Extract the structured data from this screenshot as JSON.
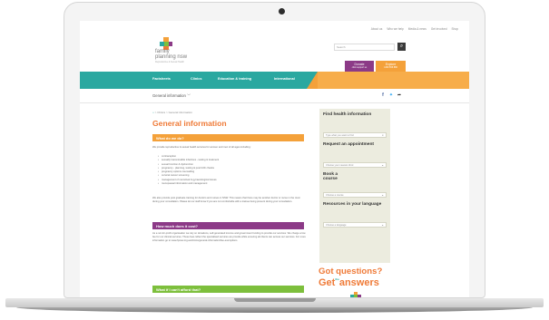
{
  "site": {
    "utility_links": [
      "About us",
      "Who we help",
      "Media & news",
      "Get involved",
      "Shop"
    ],
    "logo_line1": "family",
    "logo_line2": "planning nsw",
    "logo_tagline": "Reproductive & Sexual Health",
    "search_placeholder": "Search",
    "donate": {
      "label": "Donate",
      "sub": "click support us"
    },
    "explore": {
      "label": "Explore",
      "sub": "1300 658 886"
    }
  },
  "nav": [
    "Factsheets",
    "Clinics",
    "Education & training",
    "International"
  ],
  "subbar_title": "General information",
  "breadcrumb": {
    "home": "⌂",
    "sep": ">",
    "clinics": "Clinics",
    "current": "General information"
  },
  "page_title": "General information",
  "sections": {
    "what_we_do": "What do we do?",
    "how_much": "How much does it cost?",
    "cant_afford": "What if I can't afford that?"
  },
  "paragraphs": {
    "intro": "We provide reproductive & sexual health services for women and men of all ages including:",
    "staff": "We also provide post graduate training for doctors and nurses in NSW. This means that there may be another doctor or nurse in the room during your consultation. Please let our staff know if you are not comfortable with a trainee being present during your consultation.",
    "cost": "As a not-for-profit organisation we rely on donations, self-generated income and government funding to provide our services. We charge a low fee for our clinical services. These fees reflect the specialised services we provide while ensuring all clients can access our services. For more information go to www.fpnsw.org.au/clinics/general-information/fee-exemptions"
  },
  "bullets": [
    "contraception",
    "sexually transmissible infections - testing & treatment",
    "sexual function & dysfunction",
    "pregnancy - planning, testing & post birth checks",
    "pregnancy options counselling",
    "cervical cancer screening",
    "management of menstrual & gynaecological issues",
    "menopausal information and management"
  ],
  "sidebar": {
    "find_title": "Find health information",
    "find_placeholder": "Type what you want to find",
    "appt_title": "Request an appointment",
    "appt_value": "Choose your nearest clinic",
    "course_title": "Book a course",
    "course_value": "Choose a course",
    "lang_title": "Resources in your language",
    "lang_value": "Choose a language"
  },
  "promo": {
    "line1": "Got questions?",
    "get": "Get",
    "the": "the",
    "answers": "answers"
  },
  "colors": {
    "teal": "#2aa8a0",
    "orange": "#f4a13a",
    "purple": "#8c3a87",
    "green": "#7dbf3c",
    "title_orange": "#ef7a37"
  },
  "icons": [
    "home-icon",
    "search-icon",
    "facebook-icon",
    "twitter-icon",
    "share-icon",
    "chevron-down-icon",
    "logo-plus-icon"
  ]
}
